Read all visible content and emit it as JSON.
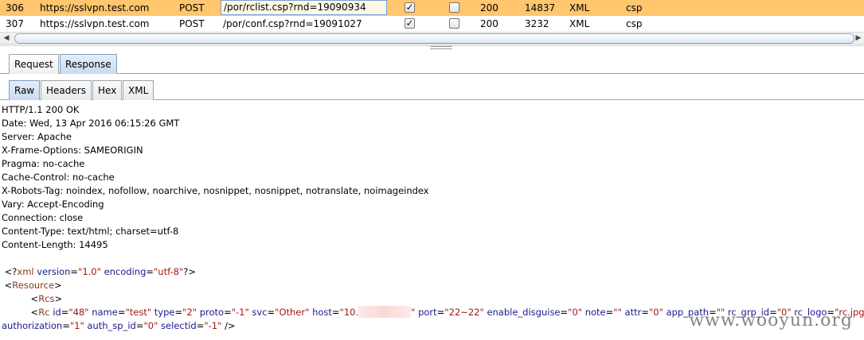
{
  "history": {
    "rows": [
      {
        "id": "306",
        "host": "https://sslvpn.test.com",
        "method": "POST",
        "url": "/por/rclist.csp?rnd=19090934",
        "params": "✓",
        "edited": "",
        "status": "200",
        "length": "14837",
        "mime": "XML",
        "ext": "csp",
        "selected": true
      },
      {
        "id": "307",
        "host": "https://sslvpn.test.com",
        "method": "POST",
        "url": "/por/conf.csp?rnd=19091027",
        "params": "✓",
        "edited": "",
        "status": "200",
        "length": "3232",
        "mime": "XML",
        "ext": "csp",
        "selected": false
      }
    ]
  },
  "scroll": {
    "left_arrow": "◀",
    "right_arrow": "▶"
  },
  "main_tabs": [
    {
      "label": "Request",
      "active": false
    },
    {
      "label": "Response",
      "active": true
    }
  ],
  "sub_tabs": [
    {
      "label": "Raw",
      "active": true
    },
    {
      "label": "Headers",
      "active": false
    },
    {
      "label": "Hex",
      "active": false
    },
    {
      "label": "XML",
      "active": false
    }
  ],
  "response": {
    "headers": [
      "HTTP/1.1 200 OK",
      "Date: Wed, 13 Apr 2016 06:15:26 GMT",
      "Server: Apache",
      "X-Frame-Options: SAMEORIGIN",
      "Pragma: no-cache",
      "Cache-Control: no-cache",
      "X-Robots-Tag: noindex, nofollow, noarchive, nosnippet, nosnippet, notranslate, noimageindex",
      "Vary: Accept-Encoding",
      "Connection: close",
      "Content-Type: text/html; charset=utf-8",
      "Content-Length: 14495"
    ],
    "xml_decl": {
      "open": "<?",
      "name": "xml",
      "attrs": [
        {
          "k": "version",
          "v": "\"1.0\""
        },
        {
          "k": "encoding",
          "v": "\"utf-8\""
        }
      ],
      "close": "?>"
    },
    "resource_tag": "Resource",
    "rcs_tag": "Rcs",
    "rc_line1": {
      "tag": "Rc",
      "attrs_before": [
        {
          "k": "id",
          "v": "\"48\""
        },
        {
          "k": "name",
          "v": "\"test\""
        },
        {
          "k": "type",
          "v": "\"2\""
        },
        {
          "k": "proto",
          "v": "\"-1\""
        },
        {
          "k": "svc",
          "v": "\"Other\""
        }
      ],
      "host_key": "host",
      "host_prefix": "\"10.",
      "host_suffix": "\"",
      "attrs_after": [
        {
          "k": "port",
          "v": "\"22~22\""
        },
        {
          "k": "enable_disguise",
          "v": "\"0\""
        },
        {
          "k": "note",
          "v": "\"\""
        },
        {
          "k": "attr",
          "v": "\"0\""
        },
        {
          "k": "app_path",
          "v": "\"\""
        },
        {
          "k": "rc_grp_id",
          "v": "\"0\""
        },
        {
          "k": "rc_logo",
          "v": "\"rc.jpg\""
        }
      ]
    },
    "rc_line2": {
      "attrs": [
        {
          "k": "authorization",
          "v": "\"1\""
        },
        {
          "k": "auth_sp_id",
          "v": "\"0\""
        },
        {
          "k": "selectid",
          "v": "\"-1\""
        }
      ],
      "close": "/>"
    }
  },
  "watermark": "www.wooyun.org"
}
